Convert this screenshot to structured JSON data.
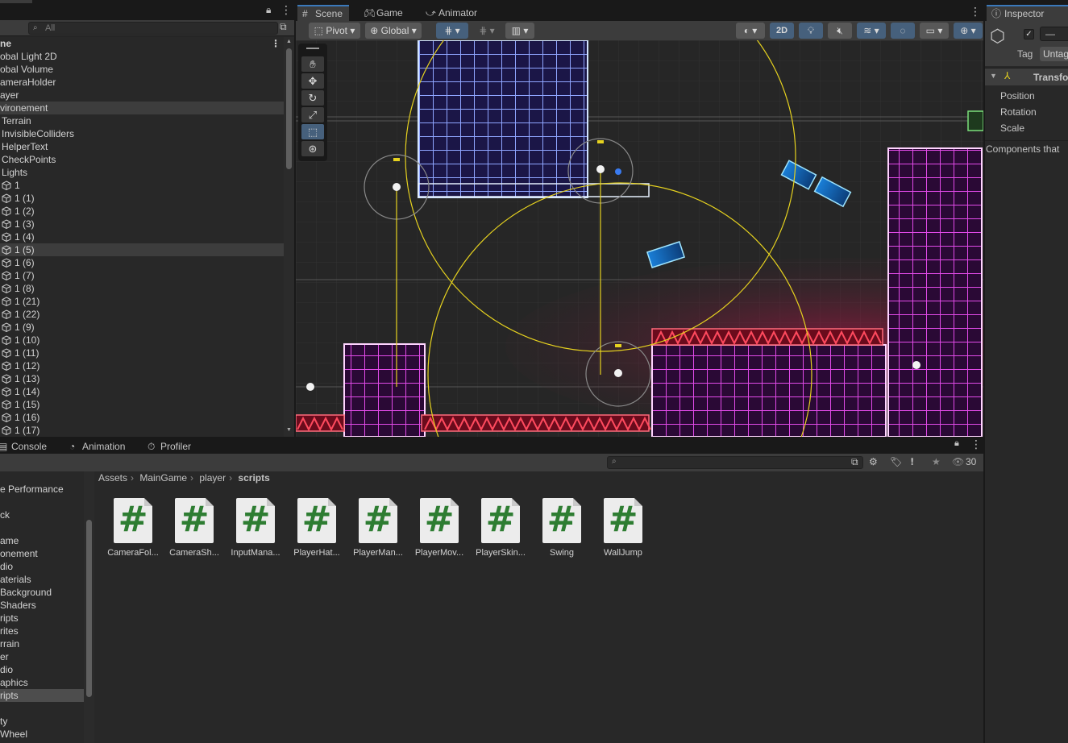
{
  "hierarchy": {
    "search_placeholder": "All",
    "header": "ne",
    "rows": [
      {
        "label": "obal Light 2D",
        "indent": 0,
        "cube": false,
        "selected": false
      },
      {
        "label": "obal Volume",
        "indent": 0,
        "cube": false,
        "selected": false
      },
      {
        "label": "ameraHolder",
        "indent": 0,
        "cube": false,
        "selected": false
      },
      {
        "label": "ayer",
        "indent": 0,
        "cube": false,
        "selected": false
      },
      {
        "label": "vironement",
        "indent": 0,
        "cube": false,
        "selected": true
      },
      {
        "label": "Terrain",
        "indent": 1,
        "cube": false,
        "selected": false
      },
      {
        "label": "InvisibleColliders",
        "indent": 1,
        "cube": false,
        "selected": false
      },
      {
        "label": "HelperText",
        "indent": 1,
        "cube": false,
        "selected": false
      },
      {
        "label": "CheckPoints",
        "indent": 1,
        "cube": false,
        "selected": false
      },
      {
        "label": "Lights",
        "indent": 1,
        "cube": false,
        "selected": false
      },
      {
        "label": "1",
        "indent": 2,
        "cube": true,
        "selected": false
      },
      {
        "label": "1 (1)",
        "indent": 2,
        "cube": true,
        "selected": false
      },
      {
        "label": "1 (2)",
        "indent": 2,
        "cube": true,
        "selected": false
      },
      {
        "label": "1 (3)",
        "indent": 2,
        "cube": true,
        "selected": false
      },
      {
        "label": "1 (4)",
        "indent": 2,
        "cube": true,
        "selected": false
      },
      {
        "label": "1 (5)",
        "indent": 2,
        "cube": true,
        "selected": true
      },
      {
        "label": "1 (6)",
        "indent": 2,
        "cube": true,
        "selected": false
      },
      {
        "label": "1 (7)",
        "indent": 2,
        "cube": true,
        "selected": false
      },
      {
        "label": "1 (8)",
        "indent": 2,
        "cube": true,
        "selected": false
      },
      {
        "label": "1 (21)",
        "indent": 2,
        "cube": true,
        "selected": false
      },
      {
        "label": "1 (22)",
        "indent": 2,
        "cube": true,
        "selected": false
      },
      {
        "label": "1 (9)",
        "indent": 2,
        "cube": true,
        "selected": false
      },
      {
        "label": "1 (10)",
        "indent": 2,
        "cube": true,
        "selected": false
      },
      {
        "label": "1 (11)",
        "indent": 2,
        "cube": true,
        "selected": false
      },
      {
        "label": "1 (12)",
        "indent": 2,
        "cube": true,
        "selected": false
      },
      {
        "label": "1 (13)",
        "indent": 2,
        "cube": true,
        "selected": false
      },
      {
        "label": "1 (14)",
        "indent": 2,
        "cube": true,
        "selected": false
      },
      {
        "label": "1 (15)",
        "indent": 2,
        "cube": true,
        "selected": false
      },
      {
        "label": "1 (16)",
        "indent": 2,
        "cube": true,
        "selected": false
      },
      {
        "label": "1 (17)",
        "indent": 2,
        "cube": true,
        "selected": false
      }
    ]
  },
  "scene": {
    "tabs": {
      "scene": "Scene",
      "game": "Game",
      "animator": "Animator"
    },
    "toolbar": {
      "pivot": "Pivot",
      "global": "Global",
      "mode_2d": "2D"
    }
  },
  "inspector": {
    "tab": "Inspector",
    "tag_label": "Tag",
    "tag_value": "Untag",
    "name_value": "—",
    "transform_label": "Transfo",
    "position_label": "Position",
    "rotation_label": "Rotation",
    "scale_label": "Scale",
    "components_note": "Components that"
  },
  "bottom": {
    "tabs": {
      "console": "Console",
      "animation": "Animation",
      "profiler": "Profiler"
    },
    "visible_count": "30",
    "breadcrumb": [
      "Assets",
      "MainGame",
      "player",
      "scripts"
    ],
    "tree": [
      {
        "label": "e Performance",
        "selected": false
      },
      {
        "label": "",
        "selected": false
      },
      {
        "label": "ck",
        "selected": false
      },
      {
        "label": "",
        "selected": false
      },
      {
        "label": "ame",
        "selected": false
      },
      {
        "label": "onement",
        "selected": false
      },
      {
        "label": "dio",
        "selected": false
      },
      {
        "label": "aterials",
        "selected": false
      },
      {
        "label": "Background",
        "selected": false
      },
      {
        "label": "Shaders",
        "selected": false
      },
      {
        "label": "ripts",
        "selected": false
      },
      {
        "label": "rites",
        "selected": false
      },
      {
        "label": "rrain",
        "selected": false
      },
      {
        "label": "er",
        "selected": false
      },
      {
        "label": "dio",
        "selected": false
      },
      {
        "label": "aphics",
        "selected": false
      },
      {
        "label": "ripts",
        "selected": true
      },
      {
        "label": "",
        "selected": false
      },
      {
        "label": "ty",
        "selected": false
      },
      {
        "label": "Wheel",
        "selected": false
      }
    ],
    "assets": [
      "CameraFol...",
      "CameraSh...",
      "InputMana...",
      "PlayerHat...",
      "PlayerMan...",
      "PlayerMov...",
      "PlayerSkin...",
      "Swing",
      "WallJump"
    ]
  },
  "colors": {
    "accent": "#3a79bb",
    "csharp_icon": "#2e7d32",
    "gizmo": "#e6d21f",
    "neon_pink": "#ff3ad6",
    "neon_blue": "#5ab8ff",
    "neon_red": "#ff3344"
  }
}
